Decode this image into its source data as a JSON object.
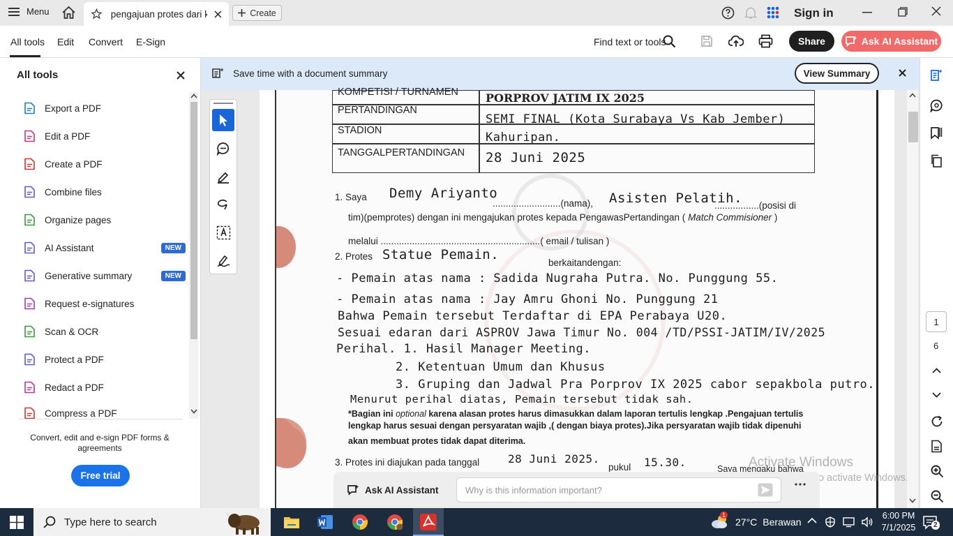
{
  "titlebar": {
    "menu_label": "Menu",
    "tab_title": "pengajuan protes dari k...",
    "create_label": "Create",
    "sign_in": "Sign in"
  },
  "toolbar": {
    "nav": [
      "All tools",
      "Edit",
      "Convert",
      "E-Sign"
    ],
    "find": "Find text or tools",
    "share": "Share",
    "ask_ai": "Ask AI Assistant"
  },
  "left_panel": {
    "title": "All tools",
    "tools": [
      {
        "label": "Export a PDF",
        "icon": "export-pdf-icon",
        "color": "#1e7fc1",
        "badge": ""
      },
      {
        "label": "Edit a PDF",
        "icon": "edit-pdf-icon",
        "color": "#c2338a",
        "badge": ""
      },
      {
        "label": "Create a PDF",
        "icon": "create-pdf-icon",
        "color": "#d9322c",
        "badge": ""
      },
      {
        "label": "Combine files",
        "icon": "combine-files-icon",
        "color": "#5b5bd6",
        "badge": ""
      },
      {
        "label": "Organize pages",
        "icon": "organize-pages-icon",
        "color": "#3b9a3b",
        "badge": ""
      },
      {
        "label": "AI Assistant",
        "icon": "ai-assistant-icon",
        "color": "#5b5bd6",
        "badge": "NEW"
      },
      {
        "label": "Generative summary",
        "icon": "generative-summary-icon",
        "color": "#5b5bd6",
        "badge": "NEW"
      },
      {
        "label": "Request e-signatures",
        "icon": "request-esign-icon",
        "color": "#a13cc2",
        "badge": ""
      },
      {
        "label": "Scan & OCR",
        "icon": "scan-ocr-icon",
        "color": "#3b9a3b",
        "badge": ""
      },
      {
        "label": "Protect a PDF",
        "icon": "protect-pdf-icon",
        "color": "#5b5bd6",
        "badge": ""
      },
      {
        "label": "Redact a PDF",
        "icon": "redact-pdf-icon",
        "color": "#c2338a",
        "badge": ""
      },
      {
        "label": "Compress a PDF",
        "icon": "compress-pdf-icon",
        "color": "#d9322c",
        "badge": ""
      }
    ],
    "promo": "Convert, edit and e-sign PDF forms & agreements",
    "free_trial": "Free trial"
  },
  "banner": {
    "text": "Save time with a document summary",
    "button": "View Summary"
  },
  "document": {
    "table": [
      {
        "label": "KOMPETISI / TURNAMEN",
        "value": "PORPROV JATIM IX 2025"
      },
      {
        "label": "PERTANDINGAN",
        "value": "SEMI FINAL (Kota Surabaya Vs Kab Jember)"
      },
      {
        "label": "STADION",
        "value": "Kahuripan."
      },
      {
        "label": "TANGGALPERTANDINGAN",
        "value": "28 Juni 2025"
      }
    ],
    "item1": {
      "num": "1. Saya",
      "name": "Demy Ariyanto",
      "nama_suffix": "..........................(nama),",
      "position": "Asisten Pelatih.",
      "posisi_suffix": ".................(posisi di",
      "line2": "tim)(pemprotes) dengan ini mengajukan protes kepada PengawasPertandingan (",
      "line2_italic": "Match Commisioner",
      "line2_end": ")",
      "line3": "melalui .............................................................( email / tulisan )"
    },
    "item2": {
      "num": "2. Protes",
      "subject": "Statue Pemain.",
      "connector": "berkaitandengan:",
      "hand_lines": [
        "- Pemain atas nama : Sadida Nugraha Putra.  No. Punggung 55.",
        "- Pemain atas nama : Jay Amru Ghoni   No. Punggung 21",
        "Bahwa Pemain tersebut Terdaftar di EPA Perabaya U20.",
        "Sesuai edaran dari ASPROV Jawa Timur No. 004 /TD/PSSI-JATIM/IV/2025",
        "Perihal. 1. Hasil Manager Meeting.",
        "2. Ketentuan Umum dan Khusus",
        "3. Gruping dan Jadwal Pra Porprov IX 2025 cabor sepakbola putro.",
        "Menurut perihal diatas, Pemain tersebut tidak sah."
      ],
      "note_1a": "*Bagian ini",
      "note_1b": "optional",
      "note_1c": "karena alasan protes harus dimasukkan dalam laporan tertulis lengkap .Pengajuan tertulis",
      "note_2": "lengkap harus  sesuai dengan persyaratan wajib   ,( dengan biaya protes).Jika persyaratan wajib tidak dipenuhi",
      "note_3": "akan membuat protes tidak dapat diterima."
    },
    "item3": {
      "text": "3.  Protes ini diajukan pada tanggal",
      "date": "28 Juni 2025.",
      "pukul": "pukul",
      "time": "15.30.",
      "tail": "Saya mengaku bahwa"
    }
  },
  "ai_bar": {
    "label": "Ask AI Assistant",
    "placeholder": "Why is this information important?"
  },
  "right_rail": {
    "current_page": "1",
    "total_pages": "6"
  },
  "watermark": {
    "line1": "Activate Windows",
    "line2": "Go to Settings to activate Windows."
  },
  "taskbar": {
    "search_placeholder": "Type here to search",
    "weather_badge": "1",
    "temperature": "27°C",
    "condition": "Berawan",
    "time": "6:00 PM",
    "date": "7/1/2025",
    "notifications": "2"
  },
  "colors": {
    "accent_blue": "#1a66d6",
    "ai_button": "#f06a6a",
    "banner_bg": "#dce9f9",
    "taskbar_bg": "#1c2b3e"
  }
}
